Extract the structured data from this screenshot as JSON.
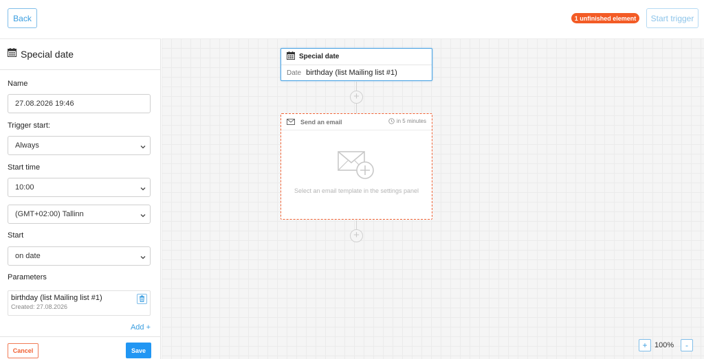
{
  "header": {
    "back_label": "Back",
    "unfinished_badge": "1 unfinished element",
    "start_trigger_label": "Start trigger"
  },
  "sidebar": {
    "title": "Special date",
    "name_label": "Name",
    "name_value": "27.08.2026 19:46",
    "trigger_start_label": "Trigger start:",
    "trigger_start_value": "Always",
    "start_time_label": "Start time",
    "start_time_value": "10:00",
    "timezone_value": "(GMT+02:00) Tallinn",
    "start_label": "Start",
    "start_value": "on date",
    "parameters_label": "Parameters",
    "parameter": {
      "name": "birthday (list Mailing list #1)",
      "created": "Created: 27.08.2026"
    },
    "add_label": "Add +",
    "cancel_label": "Cancel",
    "save_label": "Save"
  },
  "canvas": {
    "trigger_node": {
      "title": "Special date",
      "field_label": "Date",
      "field_value": "birthday (list Mailing list #1)"
    },
    "email_node": {
      "title": "Send an email",
      "delay": "in 5 minutes",
      "hint": "Select an email template in the settings panel"
    },
    "zoom": {
      "in_label": "+",
      "level": "100%",
      "out_label": "-"
    }
  },
  "colors": {
    "accent": "#2196f3",
    "warning": "#f35b25",
    "canvas_bg": "#f5f5f5"
  }
}
